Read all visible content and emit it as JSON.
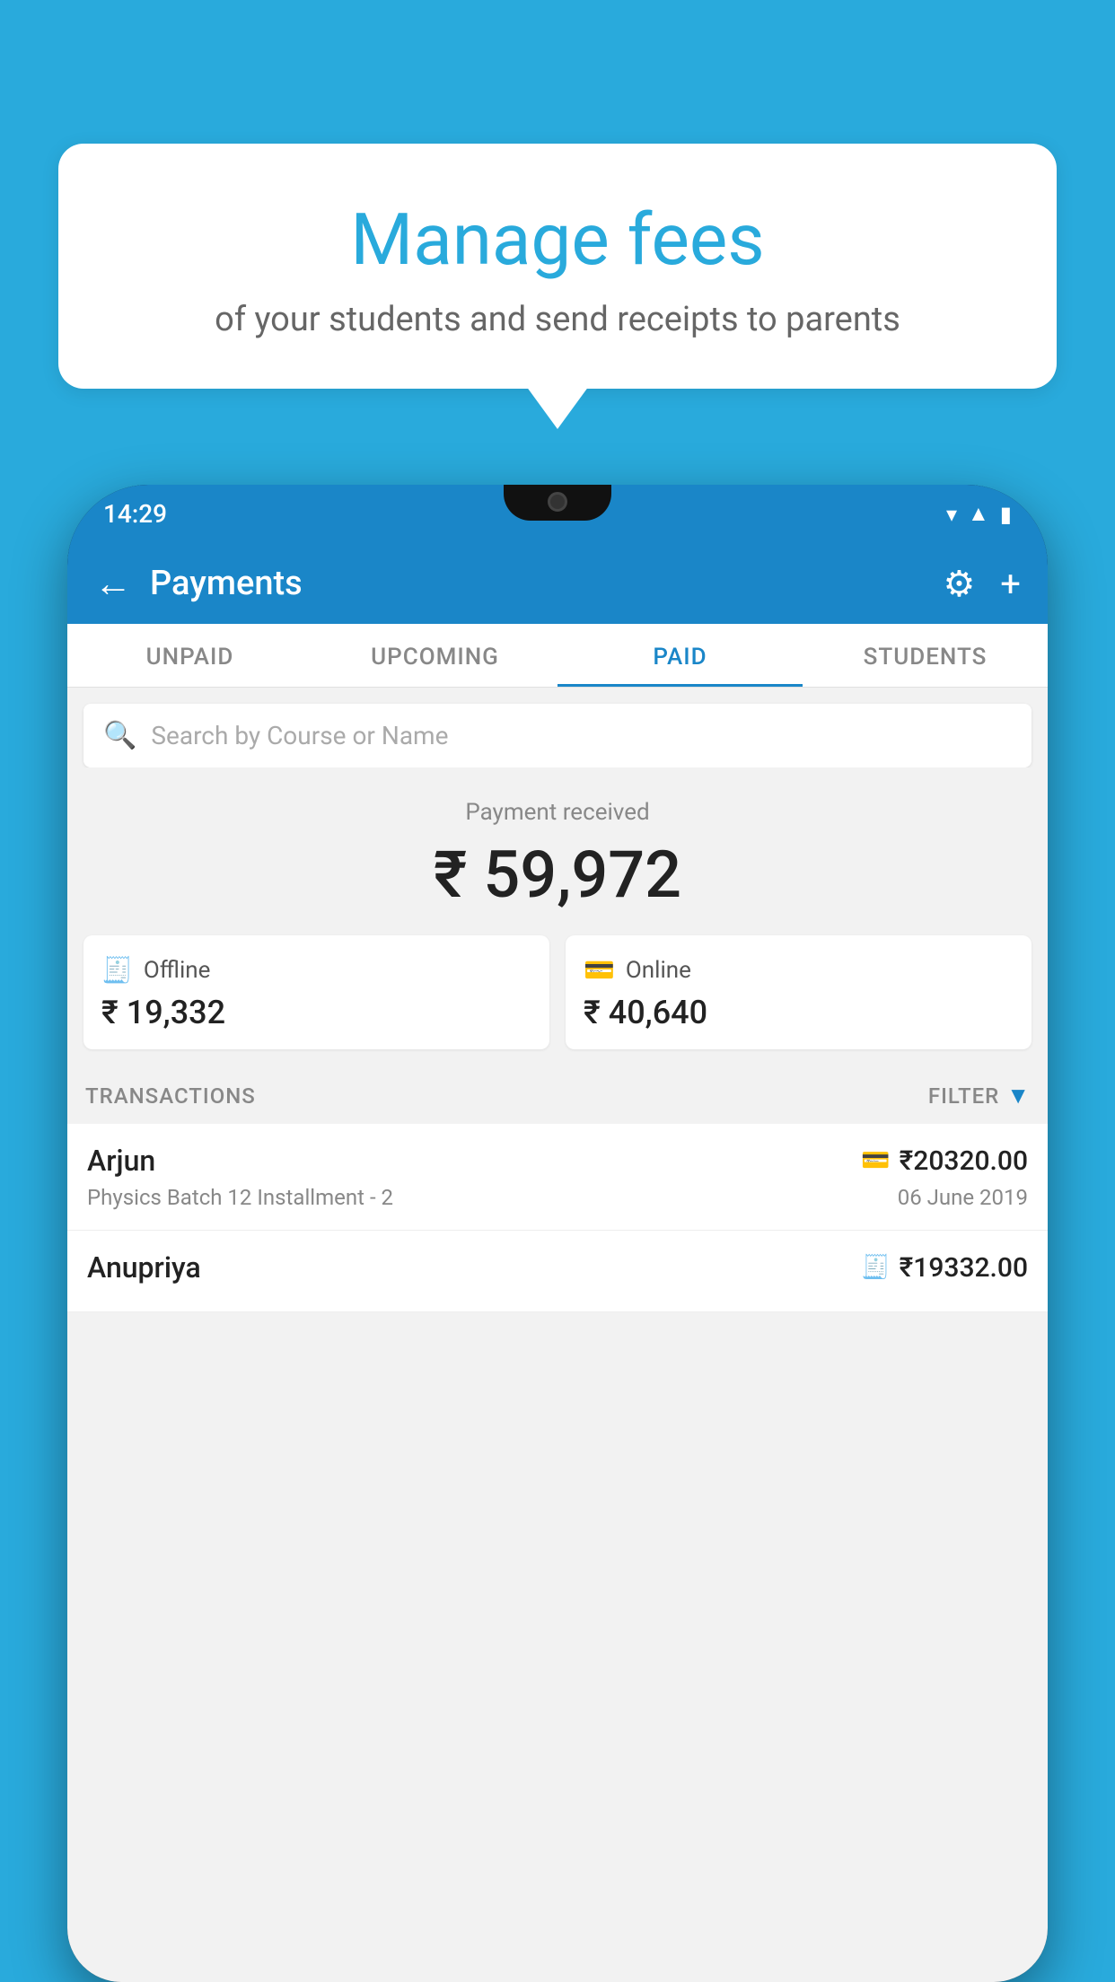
{
  "background_color": "#29AADC",
  "speech_bubble": {
    "title": "Manage fees",
    "subtitle": "of your students and send receipts to parents"
  },
  "status_bar": {
    "time": "14:29",
    "wifi_icon": "▲",
    "signal_icon": "▲",
    "battery_icon": "▮"
  },
  "header": {
    "back_label": "←",
    "title": "Payments",
    "settings_icon": "⚙",
    "add_icon": "+"
  },
  "tabs": [
    {
      "label": "UNPAID",
      "active": false
    },
    {
      "label": "UPCOMING",
      "active": false
    },
    {
      "label": "PAID",
      "active": true
    },
    {
      "label": "STUDENTS",
      "active": false
    }
  ],
  "search": {
    "placeholder": "Search by Course or Name"
  },
  "payment_summary": {
    "label": "Payment received",
    "amount": "₹ 59,972",
    "offline": {
      "label": "Offline",
      "amount": "₹ 19,332"
    },
    "online": {
      "label": "Online",
      "amount": "₹ 40,640"
    }
  },
  "transactions": {
    "header_label": "TRANSACTIONS",
    "filter_label": "FILTER",
    "rows": [
      {
        "name": "Arjun",
        "course": "Physics Batch 12 Installment - 2",
        "amount": "₹20320.00",
        "date": "06 June 2019",
        "mode": "online"
      },
      {
        "name": "Anupriya",
        "course": "",
        "amount": "₹19332.00",
        "date": "",
        "mode": "offline"
      }
    ]
  }
}
